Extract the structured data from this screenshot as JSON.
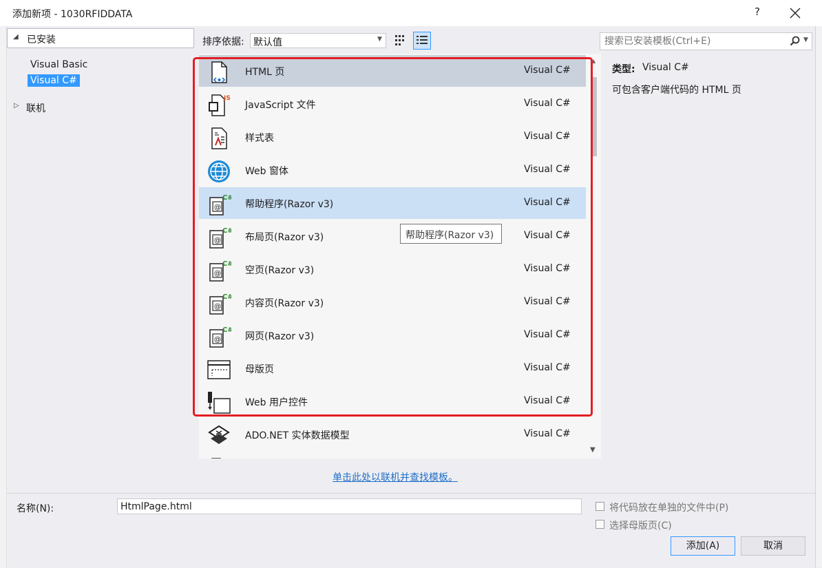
{
  "window": {
    "title": "添加新项 - 1030RFIDDATA",
    "help": "?",
    "close": "close"
  },
  "tree": {
    "header": "已安装",
    "items": [
      "Visual Basic",
      "Visual C#"
    ],
    "selected": "Visual C#",
    "online": "联机"
  },
  "toolbar": {
    "sort_label": "排序依据:",
    "sort_value": "默认值"
  },
  "search": {
    "placeholder": "搜索已安装模板(Ctrl+E)"
  },
  "templates": [
    {
      "name": "HTML 页",
      "type": "Visual C#",
      "icon": "html-page-icon"
    },
    {
      "name": "JavaScript 文件",
      "type": "Visual C#",
      "icon": "javascript-file-icon"
    },
    {
      "name": "样式表",
      "type": "Visual C#",
      "icon": "stylesheet-icon"
    },
    {
      "name": "Web 窗体",
      "type": "Visual C#",
      "icon": "web-form-icon"
    },
    {
      "name": "帮助程序(Razor v3)",
      "type": "Visual C#",
      "icon": "razor-page-icon"
    },
    {
      "name": "布局页(Razor v3)",
      "type": "Visual C#",
      "icon": "razor-page-icon"
    },
    {
      "name": "空页(Razor v3)",
      "type": "Visual C#",
      "icon": "razor-page-icon"
    },
    {
      "name": "内容页(Razor v3)",
      "type": "Visual C#",
      "icon": "razor-page-icon"
    },
    {
      "name": "网页(Razor v3)",
      "type": "Visual C#",
      "icon": "razor-page-icon"
    },
    {
      "name": "母版页",
      "type": "Visual C#",
      "icon": "master-page-icon"
    },
    {
      "name": "Web 用户控件",
      "type": "Visual C#",
      "icon": "web-user-control-icon"
    },
    {
      "name": "ADO.NET 实体数据模型",
      "type": "Visual C#",
      "icon": "entity-model-icon"
    }
  ],
  "tooltip": "帮助程序(Razor v3)",
  "details": {
    "type_label": "类型:",
    "type_value": "Visual C#",
    "description": "可包含客户端代码的 HTML 页"
  },
  "online_link": "单击此处以联机并查找模板。",
  "bottom": {
    "name_label": "名称(N):",
    "name_value": "HtmlPage.html",
    "checkbox1": "将代码放在单独的文件中(P)",
    "checkbox2": "选择母版页(C)",
    "add_button": "添加(A)",
    "cancel_button": "取消"
  },
  "colors": {
    "accent": "#3399ff",
    "highlight_box": "#e51c23",
    "hover_row": "#c9d1dd",
    "selected_row": "#cbdff5"
  }
}
